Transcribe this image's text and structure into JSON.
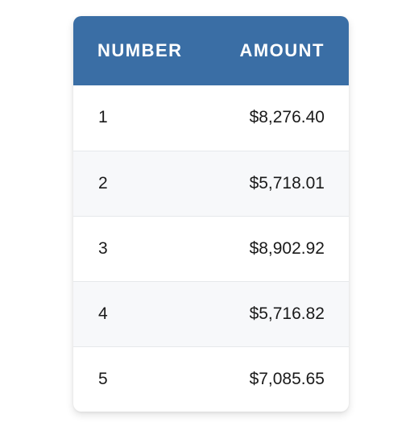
{
  "table": {
    "headers": {
      "number": "NUMBER",
      "amount": "AMOUNT"
    },
    "rows": [
      {
        "number": "1",
        "amount": "$8,276.40"
      },
      {
        "number": "2",
        "amount": "$5,718.01"
      },
      {
        "number": "3",
        "amount": "$8,902.92"
      },
      {
        "number": "4",
        "amount": "$5,716.82"
      },
      {
        "number": "5",
        "amount": "$7,085.65"
      }
    ]
  },
  "colors": {
    "header_bg": "#3a6ea5",
    "header_text": "#ffffff",
    "row_alt_bg": "#f7f8fa",
    "row_border": "#e6e8eb"
  }
}
